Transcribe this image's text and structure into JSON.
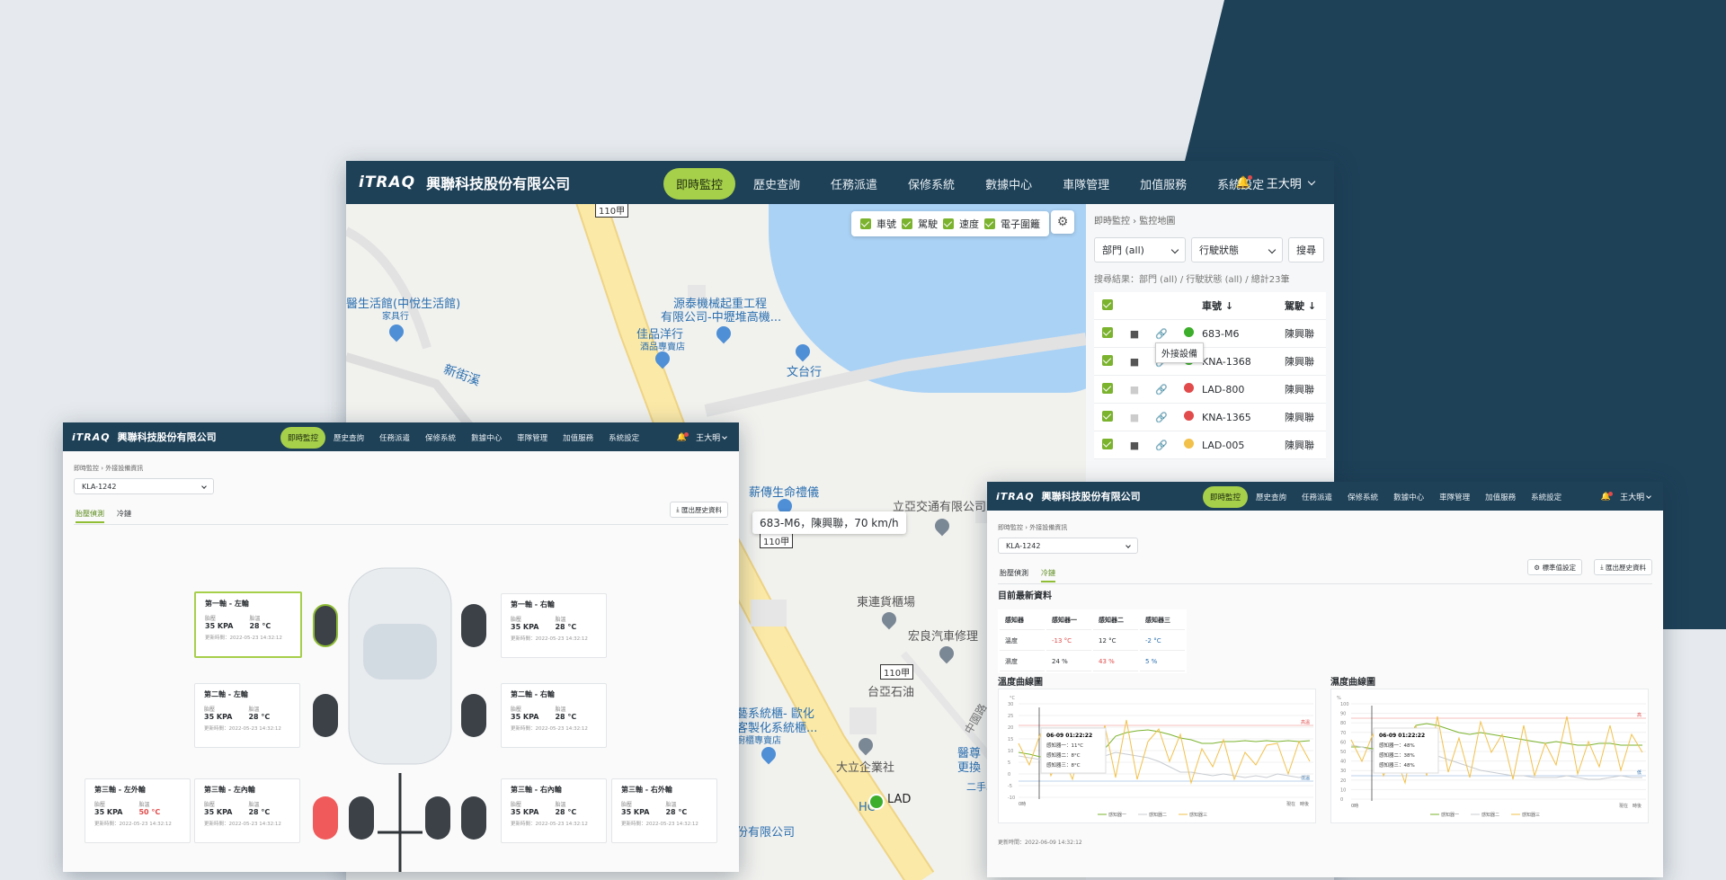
{
  "colors": {
    "nav": "#1e4158",
    "accent": "#a6cf4a",
    "bg": "#e6eaee",
    "dark": "#1e4158"
  },
  "main": {
    "logo": "iTRAQ",
    "company": "興聯科技股份有限公司",
    "menu": [
      "即時監控",
      "歷史查詢",
      "任務派遣",
      "保修系統",
      "數據中心",
      "車隊管理",
      "加值服務",
      "系統設定"
    ],
    "user": "王大明",
    "map_toggles": [
      "車號",
      "駕駛",
      "速度",
      "電子圍籬"
    ],
    "map_labels": {
      "poi1": "醫生活館(中悅生活館)",
      "poi1sub": "家具行",
      "poi2": "源泰機械起重工程",
      "poi2b": "有限公司-中壢堆高機...",
      "poi3": "佳品洋行",
      "poi3sub": "酒品專賣店",
      "poi4": "文台行",
      "poi5": "新街溪",
      "poi6": "薪傳生命禮儀",
      "poi7": "立亞交通有限公司",
      "poi8": "東連貨櫃場",
      "poi9": "宏良汽車修理",
      "poi10": "台亞石油",
      "poi11": "大立企業社",
      "poi12": "藝系統櫃- 歐化",
      "poi12b": "客製化系統櫃...",
      "poi12c": "廚櫃專賣店",
      "poi13": "份有限公司",
      "poi14": "中園路",
      "poi15": "醫尊",
      "poi16": "更換",
      "poi17": "二手車",
      "road1": "110甲",
      "road2": "110甲",
      "road3": "110甲",
      "vehicle_label": "683-M6，陳興聯，70 km/h",
      "lad": "LAD",
      "hc": "HC"
    },
    "side": {
      "breadcrumb": [
        "即時監控",
        "監控地圖"
      ],
      "dept": "部門 (all)",
      "status": "行駛狀態",
      "search": "搜尋",
      "result": "搜尋結果：部門 (all) / 行駛狀態 (all) / 總計23筆",
      "col_plate": "車號",
      "col_driver": "駕駛",
      "tooltip": "外接設備",
      "rows": [
        {
          "plate": "683-M6",
          "driver": "陳興聯",
          "status": "#3dae2b"
        },
        {
          "plate": "KNA-1368",
          "driver": "陳興聯",
          "status": "#3dae2b"
        },
        {
          "plate": "LAD-800",
          "driver": "陳興聯",
          "status": "#e24b4b"
        },
        {
          "plate": "KNA-1365",
          "driver": "陳興聯",
          "status": "#e24b4b"
        },
        {
          "plate": "LAD-005",
          "driver": "陳興聯",
          "status": "#f2c14b"
        }
      ]
    }
  },
  "tire": {
    "breadcrumb": [
      "即時監控",
      "外接設備資訊"
    ],
    "vehicle": "KLA-1242",
    "tabs": [
      "胎壓偵測",
      "冷鏈"
    ],
    "export": "匯出歷史資料",
    "lab_p": "胎壓",
    "lab_t": "胎溫",
    "cards": [
      {
        "title": "第一軸 - 左輪",
        "p": "35 KPA",
        "t": "28 °C",
        "u": "更新時間：2022-05-23 14:32:12"
      },
      {
        "title": "第一軸 - 右輪",
        "p": "35 KPA",
        "t": "28 °C",
        "u": "更新時間：2022-05-23 14:32:12"
      },
      {
        "title": "第二軸 - 左輪",
        "p": "35 KPA",
        "t": "28 °C",
        "u": "更新時間：2022-05-23 14:32:12"
      },
      {
        "title": "第二軸 - 右輪",
        "p": "35 KPA",
        "t": "28 °C",
        "u": "更新時間：2022-05-23 14:32:12"
      },
      {
        "title": "第三軸 - 左外輪",
        "p": "35 KPA",
        "t": "50 °C",
        "u": "更新時間：2022-05-23 14:32:12"
      },
      {
        "title": "第三軸 - 左內輪",
        "p": "35 KPA",
        "t": "28 °C",
        "u": "更新時間：2022-05-23 14:32:12"
      },
      {
        "title": "第三軸 - 右內輪",
        "p": "35 KPA",
        "t": "28 °C",
        "u": "更新時間：2022-05-23 14:32:12"
      },
      {
        "title": "第三軸 - 右外輪",
        "p": "35 KPA",
        "t": "28 °C",
        "u": "更新時間：2022-05-23 14:32:12"
      }
    ]
  },
  "cold": {
    "breadcrumb": [
      "即時監控",
      "外接設備資訊"
    ],
    "vehicle": "KLA-1242",
    "tabs": [
      "胎壓偵測",
      "冷鏈"
    ],
    "std": "標準值設定",
    "export": "匯出歷史資料",
    "latest": "目前最新資料",
    "table": {
      "head": [
        "感知器",
        "感知器一",
        "感知器二",
        "感知器三"
      ],
      "rows": [
        [
          "溫度",
          "-13 °C",
          "12 °C",
          "-2 °C"
        ],
        [
          "濕度",
          "24 %",
          "43 %",
          "5 %"
        ]
      ]
    },
    "temp_title": "溫度曲線圖",
    "hum_title": "濕度曲線圖",
    "update": "更新時間：2022-06-09 14:32:12",
    "temp_tip": {
      "time": "06-09 01:22:22",
      "l1": "感知器一：11°C",
      "l2": "感知器二：8°C",
      "l3": "感知器三：8°C"
    },
    "hum_tip": {
      "time": "06-09 01:22:22",
      "l1": "感知器一：48%",
      "l2": "感知器二：38%",
      "l3": "感知器三：48%"
    },
    "legend": [
      "感知器一",
      "感知器二",
      "感知器三"
    ],
    "temp_hi": "高溫",
    "temp_lo": "低溫",
    "hum_hi": "高",
    "hum_lo": "低",
    "t0": "0時",
    "t1": "現在",
    "t2": "時後",
    "temp_ylabel": "°C",
    "hum_ylabel": "%",
    "temp_ticks": [
      "30",
      "25",
      "20",
      "15",
      "10",
      "5",
      "0",
      "-5",
      "-10"
    ],
    "hum_ticks": [
      "100",
      "90",
      "80",
      "70",
      "60",
      "50",
      "40",
      "30",
      "20",
      "10",
      "0"
    ]
  }
}
